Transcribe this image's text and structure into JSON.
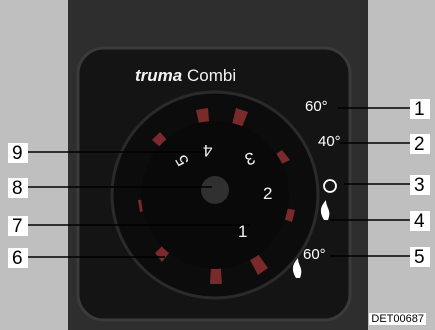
{
  "brand": {
    "name": "truma",
    "model": "Combi"
  },
  "dial_numbers": [
    "1",
    "2",
    "3",
    "4",
    "5"
  ],
  "settings": [
    {
      "symbol": "60°",
      "number": "1"
    },
    {
      "symbol": "40°",
      "number": "2"
    },
    {
      "symbol": "O",
      "number": "3"
    },
    {
      "symbol": "flame",
      "number": "4"
    },
    {
      "symbol": "60°",
      "number": "5"
    }
  ],
  "callouts": [
    "9",
    "8",
    "7",
    "6"
  ],
  "image_code": "DET00687",
  "colors": {
    "background": "#bfbfbf",
    "panel": "#141414",
    "knob": "#080808",
    "fins": "#8a2a2a"
  }
}
